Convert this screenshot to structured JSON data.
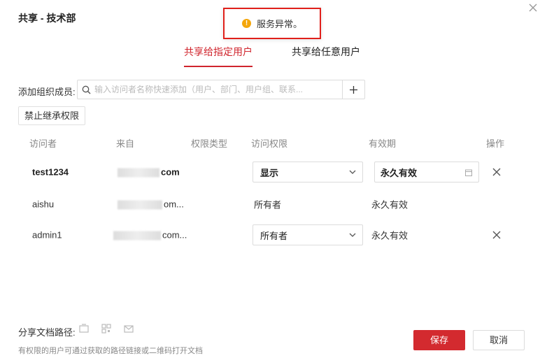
{
  "dialog": {
    "title": "共享 - 技术部"
  },
  "toast": {
    "icon": "warning-icon",
    "message": "服务异常。",
    "color": "#f4a60b"
  },
  "tabs": [
    {
      "label": "共享给指定用户",
      "active": true
    },
    {
      "label": "共享给任意用户",
      "active": false
    }
  ],
  "add_member": {
    "label": "添加组织成员:",
    "placeholder": "输入访问者名称快速添加（用户、部门、用户组、联系..."
  },
  "inherit_button": "禁止继承权限",
  "table": {
    "headers": [
      "访问者",
      "来自",
      "权限类型",
      "访问权限",
      "有效期",
      "操作"
    ],
    "rows": [
      {
        "visitor": "test1234",
        "from": "com",
        "permission": "显示",
        "validity": "永久有效",
        "editable": true
      },
      {
        "visitor": "aishu",
        "from": "om...",
        "permission": "所有者",
        "validity": "永久有效",
        "editable": false
      },
      {
        "visitor": "admin1",
        "from": "com...",
        "permission": "所有者",
        "validity": "永久有效",
        "editable": true
      }
    ]
  },
  "footer": {
    "path_label": "分享文档路径:",
    "hint": "有权限的用户可通过获取的路径链接或二维码打开文档",
    "save": "保存",
    "cancel": "取消"
  },
  "colors": {
    "accent": "#d0252d",
    "save_button": "#d32a2f",
    "toast_border": "#e0201b"
  }
}
